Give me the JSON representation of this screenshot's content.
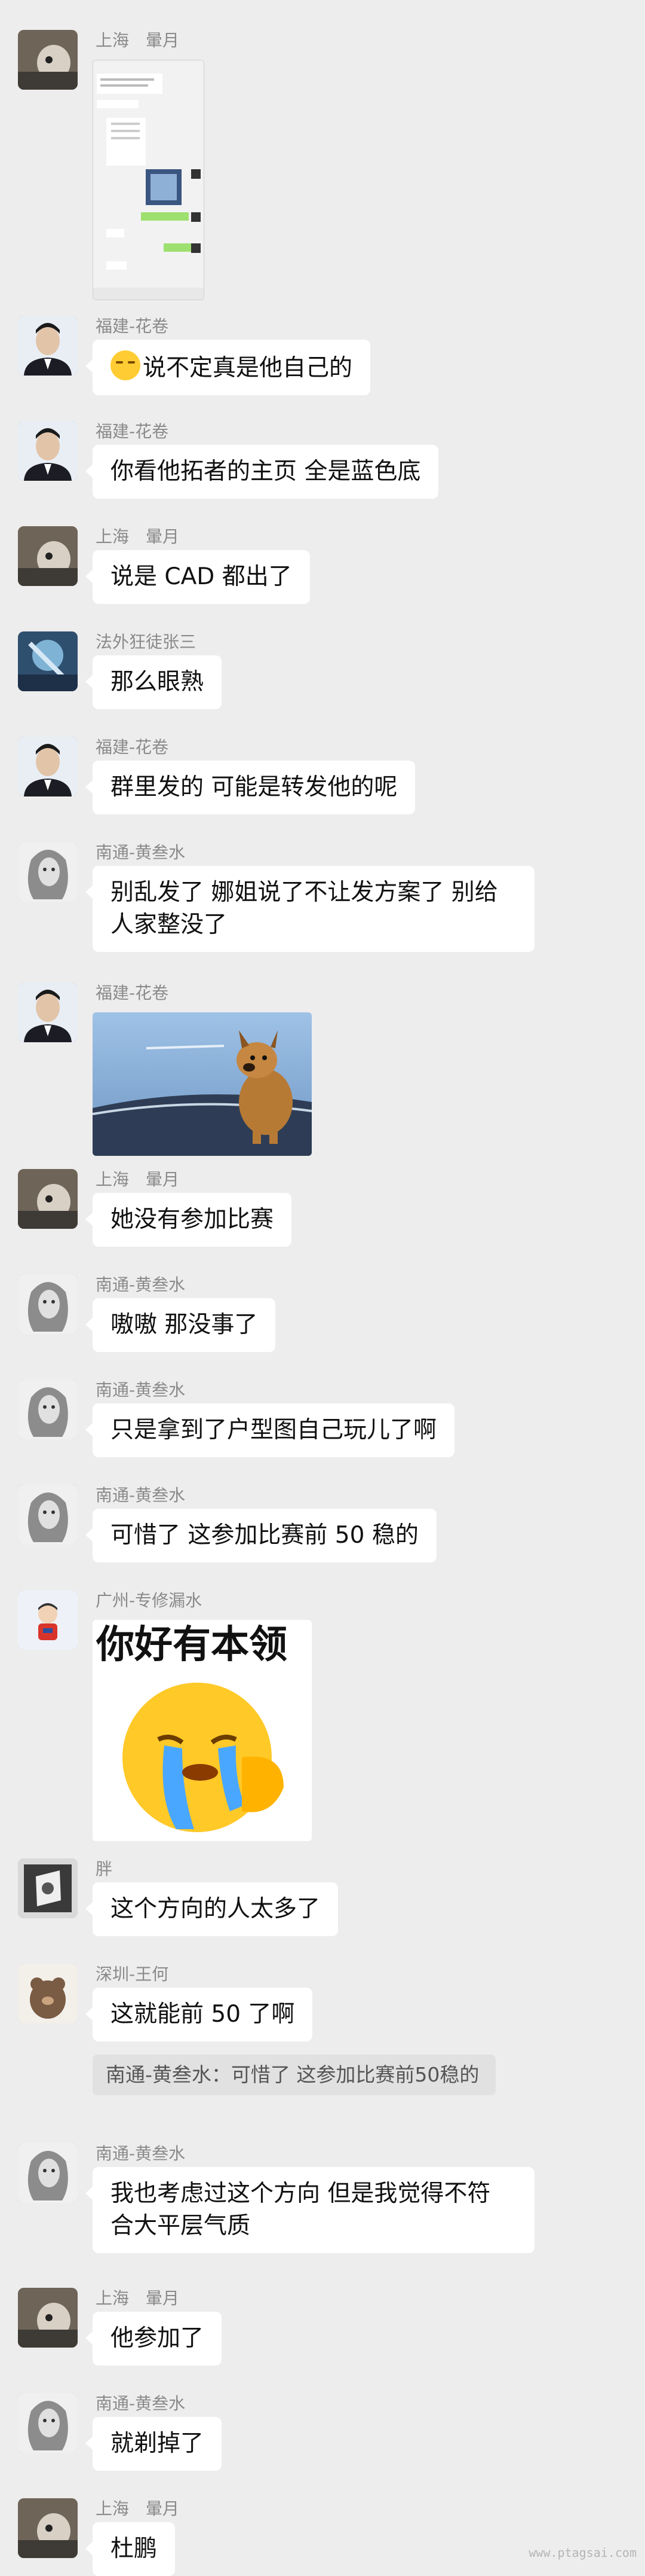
{
  "messages": [
    {
      "sender": "上海　暈月",
      "type": "screenshot"
    },
    {
      "sender": "福建-花卷",
      "text": "说不定真是他自己的",
      "emoji": "sleepy-face"
    },
    {
      "sender": "福建-花卷",
      "text": "你看他拓者的主页 全是蓝色底"
    },
    {
      "sender": "上海　暈月",
      "text": "说是 CAD 都出了"
    },
    {
      "sender": "法外狂徒张三",
      "text": "那么眼熟"
    },
    {
      "sender": "福建-花卷",
      "text": "群里发的 可能是转发他的呢"
    },
    {
      "sender": "南通-黄叁水",
      "line1": "别乱发了 娜姐说了不让发方案了 别给",
      "line2": "人家整没了"
    },
    {
      "sender": "福建-花卷",
      "type": "image"
    },
    {
      "sender": "上海　暈月",
      "text": "她没有参加比赛"
    },
    {
      "sender": "南通-黄叁水",
      "text": "嗷嗷 那没事了"
    },
    {
      "sender": "南通-黄叁水",
      "text": "只是拿到了户型图自己玩儿了啊"
    },
    {
      "sender": "南通-黄叁水",
      "text": "可惜了 这参加比赛前 50 稳的"
    },
    {
      "sender": "广州-专修漏水",
      "type": "sticker",
      "sticker_text": "你好有本领"
    },
    {
      "sender": "胖",
      "text": "这个方向的人太多了"
    },
    {
      "sender": "深圳-王何",
      "text": "这就能前 50 了啊",
      "quote": "南通-黄叁水：可惜了 这参加比赛前50稳的"
    },
    {
      "sender": "南通-黄叁水",
      "line1": "我也考虑过这个方向 但是我觉得不符",
      "line2": "合大平层气质"
    },
    {
      "sender": "上海　暈月",
      "text": "他参加了"
    },
    {
      "sender": "南通-黄叁水",
      "text": "就剃掉了"
    },
    {
      "sender": "上海　暈月",
      "text": "杜鹏"
    }
  ],
  "watermark": "www.ptagsai.com",
  "colors": {
    "background": "#ededed",
    "bubble": "#ffffff",
    "sender": "#8a8a8a"
  }
}
